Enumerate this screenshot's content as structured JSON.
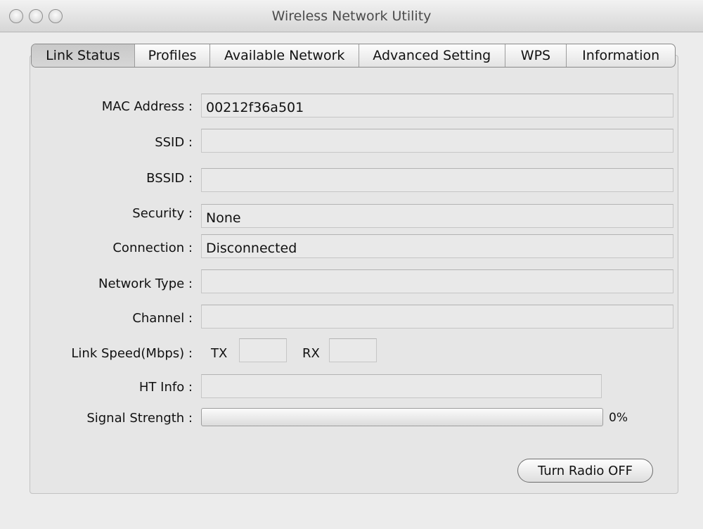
{
  "window": {
    "title": "Wireless Network Utility"
  },
  "tabs": [
    {
      "label": "Link Status",
      "active": true
    },
    {
      "label": "Profiles",
      "active": false
    },
    {
      "label": "Available Network",
      "active": false
    },
    {
      "label": "Advanced Setting",
      "active": false
    },
    {
      "label": "WPS",
      "active": false
    },
    {
      "label": "Information",
      "active": false
    }
  ],
  "fields": {
    "mac": {
      "label": "MAC Address :",
      "value": "00212f36a501"
    },
    "ssid": {
      "label": "SSID :",
      "value": ""
    },
    "bssid": {
      "label": "BSSID :",
      "value": ""
    },
    "security": {
      "label": "Security :",
      "value": "None"
    },
    "connection": {
      "label": "Connection :",
      "value": "Disconnected"
    },
    "network_type": {
      "label": "Network Type :",
      "value": ""
    },
    "channel": {
      "label": "Channel :",
      "value": ""
    },
    "link_speed": {
      "label": "Link Speed(Mbps) :",
      "tx_label": "TX",
      "tx_value": "",
      "rx_label": "RX",
      "rx_value": ""
    },
    "ht_info": {
      "label": "HT Info :",
      "value": ""
    },
    "signal": {
      "label": "Signal Strength :",
      "percent_text": "0%",
      "percent": 0
    }
  },
  "buttons": {
    "radio_toggle": "Turn Radio OFF"
  },
  "colors": {
    "progress_fill": "#4a8fe0"
  }
}
